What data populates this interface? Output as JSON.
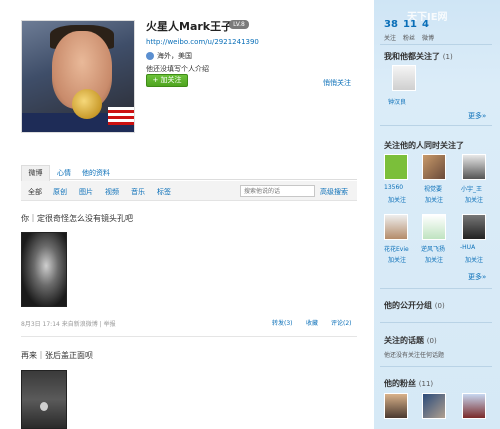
{
  "profile": {
    "name": "火星人Mark王子",
    "level_badge": "LV.8",
    "url": "http://weibo.com/u/2921241390",
    "location": "海外，美国",
    "bio": "他还没填写个人介绍",
    "follow_label": "+ 加关注",
    "whisper_link": "悄悄关注"
  },
  "tabs": [
    "微博",
    "心情",
    "他的资料"
  ],
  "filters": [
    "全部",
    "原创",
    "图片",
    "视频",
    "音乐",
    "标签"
  ],
  "search": {
    "placeholder": "搜索他说的话",
    "advanced": "高级搜索"
  },
  "posts": [
    {
      "text": "你｜定很奇怪怎么没有镜头孔吧",
      "meta": "8月3日 17:14 来自新浪微博 | 举报",
      "actions": [
        "转发(3)",
        "收藏",
        "评论(2)"
      ]
    },
    {
      "text": "再来｜张后盖正面呗"
    }
  ],
  "sidebar": {
    "watermark": "天下IE网",
    "stats": [
      {
        "num": "38",
        "label": "关注"
      },
      {
        "num": "11",
        "label": "粉丝"
      },
      {
        "num": "4",
        "label": "微博"
      }
    ],
    "common_follow": {
      "title": "我和他都关注了",
      "count": "(1)",
      "users": [
        "钟汉良"
      ],
      "more": "更多»"
    },
    "mutual_follow": {
      "title": "关注他的人同时关注了",
      "users": [
        "13560",
        "视觉要",
        "小宇_王",
        "花花Evie",
        "逆风飞扬",
        "-HUA"
      ],
      "follow": "加关注",
      "more": "更多»"
    },
    "public_groups": {
      "title": "他的公开分组",
      "count": "(0)"
    },
    "topics": {
      "title": "关注的话题",
      "count": "(0)",
      "text": "他还没有关注任何话题"
    },
    "fans": {
      "title": "他的粉丝",
      "count": "(11)"
    }
  },
  "colors": {
    "link": "#0a6fb8",
    "sidebar_bg": "#d6e9f6",
    "follow_btn": "#4fa420"
  }
}
